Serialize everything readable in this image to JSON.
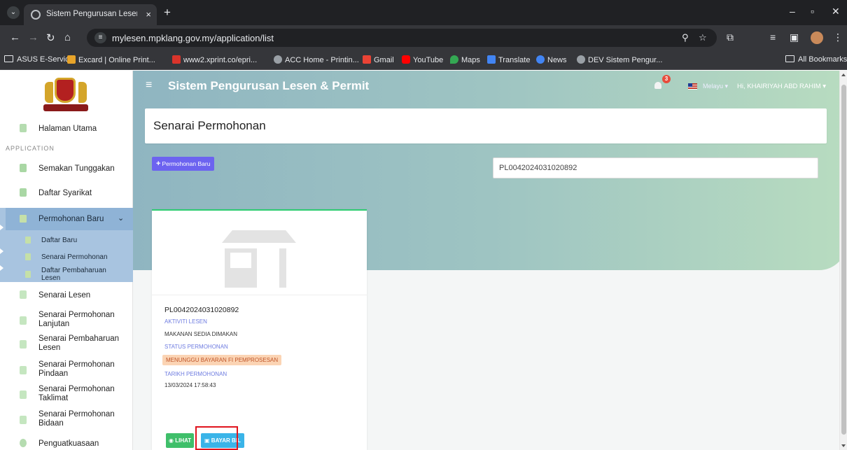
{
  "browser": {
    "tab_title": "Sistem Pengurusan Lesen & Per",
    "url": "mylesen.mpklang.gov.my/application/list",
    "bookmarks": [
      {
        "label": "ASUS E-Service",
        "icon": "folder-icon"
      },
      {
        "label": "Excard | Online Print...",
        "icon": "excard-icon"
      },
      {
        "label": "www2.xprint.co/epri...",
        "icon": "xprint-icon"
      },
      {
        "label": "ACC Home - Printin...",
        "icon": "globe-icon"
      },
      {
        "label": "Gmail",
        "icon": "gmail-icon"
      },
      {
        "label": "YouTube",
        "icon": "youtube-icon"
      },
      {
        "label": "Maps",
        "icon": "maps-icon"
      },
      {
        "label": "Translate",
        "icon": "translate-icon"
      },
      {
        "label": "News",
        "icon": "news-icon"
      },
      {
        "label": "DEV Sistem Pengur...",
        "icon": "globe-icon"
      }
    ],
    "all_bookmarks": "All Bookmarks"
  },
  "header": {
    "app_title": "Sistem Pengurusan Lesen & Permit",
    "notification_count": "3",
    "language": "Melayu",
    "user_greeting": "Hi, KHAIRIYAH ABD RAHIM"
  },
  "sidebar": {
    "home": "Halaman Utama",
    "section": "APPLICATION",
    "items": [
      {
        "label": "Semakan Tunggakan"
      },
      {
        "label": "Daftar Syarikat"
      },
      {
        "label": "Permohonan Baru"
      },
      {
        "label": "Senarai Lesen"
      },
      {
        "label": "Senarai Permohonan Lanjutan"
      },
      {
        "label": "Senarai Pembaharuan Lesen"
      },
      {
        "label": "Senarai Permohonan Pindaan"
      },
      {
        "label": "Senarai Permohonan Taklimat"
      },
      {
        "label": "Senarai Permohonan Bidaan"
      },
      {
        "label": "Penguatkuasaan"
      }
    ],
    "sub_items": [
      {
        "label": "Daftar Baru"
      },
      {
        "label": "Senarai Permohonan"
      },
      {
        "label": "Daftar Pembaharuan Lesen"
      }
    ]
  },
  "main": {
    "page_title": "Senarai Permohonan",
    "new_button": "Permohonan Baru",
    "search_value": "PL0042024031020892",
    "card": {
      "application_no": "PL0042024031020892",
      "activity_label": "AKTIVITI LESEN",
      "activity_value": "MAKANAN SEDIA DIMAKAN",
      "status_label": "STATUS PERMOHONAN",
      "status_value": "MENUNGGU BAYARAN FI PEMPROSESAN",
      "date_label": "TARIKH PERMOHONAN",
      "date_value": "13/03/2024 17:58:43",
      "view_button": "LIHAT",
      "pay_button": "BAYAR BIL"
    }
  },
  "colors": {
    "accent": "#6c63f0",
    "success": "#3fbf6a",
    "info": "#3ab4e8",
    "warning_bg": "#fbd4b4",
    "highlight": "#e0141e"
  }
}
